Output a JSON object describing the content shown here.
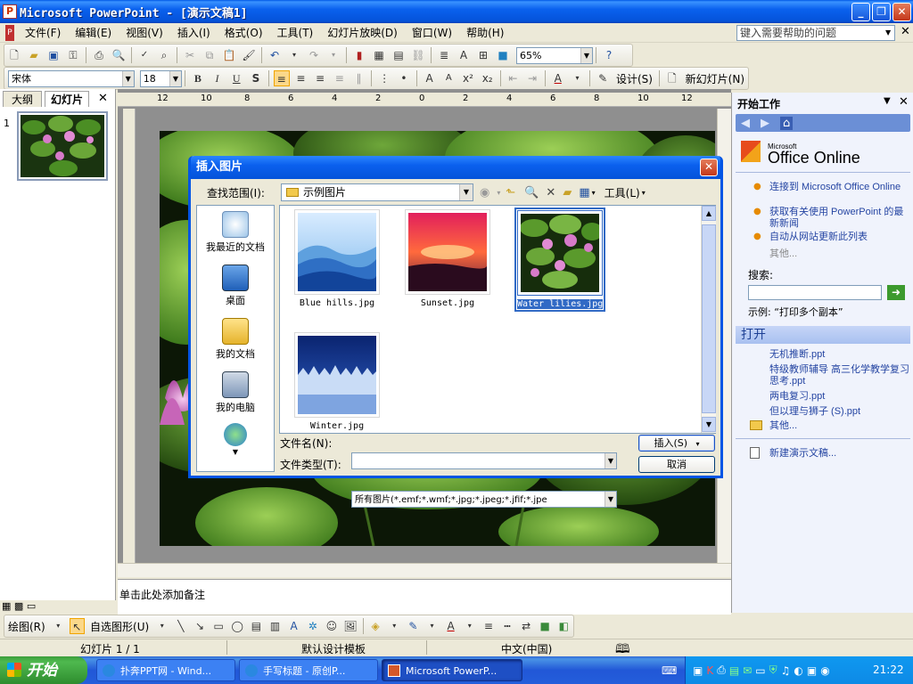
{
  "window": {
    "title": "Microsoft PowerPoint - [演示文稿1]"
  },
  "menu": {
    "items": [
      "文件(F)",
      "编辑(E)",
      "视图(V)",
      "插入(I)",
      "格式(O)",
      "工具(T)",
      "幻灯片放映(D)",
      "窗口(W)",
      "帮助(H)"
    ],
    "help_placeholder": "键入需要帮助的问题"
  },
  "standard_toolbar": {
    "zoom": "65%"
  },
  "format_toolbar": {
    "font": "宋体",
    "size": "18",
    "design_label": "设计(S)",
    "new_slide_label": "新幻灯片(N)"
  },
  "left_pane": {
    "tabs": [
      "大纲",
      "幻灯片"
    ],
    "slide_number": "1"
  },
  "ruler": {
    "labels": [
      "12",
      "10",
      "8",
      "6",
      "4",
      "2",
      "0",
      "2",
      "4",
      "6",
      "8",
      "10",
      "12"
    ]
  },
  "notes": {
    "placeholder": "单击此处添加备注"
  },
  "task_pane": {
    "title": "开始工作",
    "logo_small": "Microsoft",
    "logo": "Office Online",
    "links": [
      "连接到 Microsoft Office Online",
      "获取有关使用 PowerPoint 的最新新闻",
      "自动从网站更新此列表"
    ],
    "more": "其他...",
    "search_label": "搜索:",
    "example": "示例: “打印多个副本”",
    "open_header": "打开",
    "files": [
      "无机推断.ppt",
      "特级教师辅导 高三化学教学复习思考.ppt",
      "两电复习.ppt",
      "但以理与狮子 (S).ppt"
    ],
    "open_more": "其他...",
    "new_presentation": "新建演示文稿..."
  },
  "dialog": {
    "title": "插入图片",
    "lookin_label": "查找范围(I):",
    "lookin_value": "示例图片",
    "tools_label": "工具(L)",
    "places": [
      "我最近的文档",
      "桌面",
      "我的文档",
      "我的电脑"
    ],
    "files": [
      {
        "name": "Blue hills.jpg",
        "selected": false
      },
      {
        "name": "Sunset.jpg",
        "selected": false
      },
      {
        "name": "Water lilies.jpg",
        "selected": true
      },
      {
        "name": "Winter.jpg",
        "selected": false
      }
    ],
    "filename_label": "文件名(N):",
    "filename_value": "",
    "filetype_label": "文件类型(T):",
    "filetype_value": "所有图片(*.emf;*.wmf;*.jpg;*.jpeg;*.jfif;*.jpe",
    "insert_label": "插入(S)",
    "cancel_label": "取消"
  },
  "draw_toolbar": {
    "draw_label": "绘图(R)",
    "autoshapes_label": "自选图形(U)"
  },
  "status": {
    "slide": "幻灯片 1 / 1",
    "template": "默认设计模板",
    "language": "中文(中国)"
  },
  "taskbar": {
    "start": "开始",
    "buttons": [
      "扑奔PPT网 - Wind...",
      "手写标题 - 原创P...",
      "Microsoft PowerP..."
    ],
    "clock": "21:22"
  }
}
